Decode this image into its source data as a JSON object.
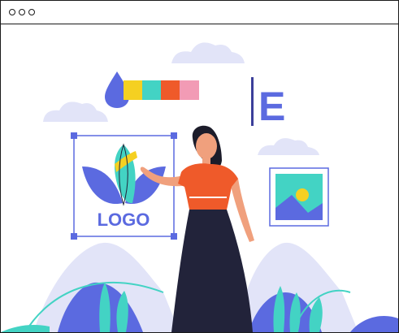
{
  "window": {
    "controls": [
      "window-dot-1",
      "window-dot-2",
      "window-dot-3"
    ]
  },
  "artwork": {
    "logo_text": "LOGO",
    "typography_letter": "E",
    "swatch_colors": [
      "#f5d021",
      "#43d3c4",
      "#ef5a2a",
      "#f29bb5"
    ],
    "colors": {
      "accent": "#5b6ae0",
      "accent_light": "#d9dcf7",
      "cloud": "#e2e4f8",
      "teal": "#43d3c4",
      "orange": "#ef5a2a",
      "skirt": "#22233a",
      "skin": "#f0a07d",
      "hair": "#1c1c2a",
      "sun": "#f5d021"
    },
    "icons": [
      "color-drop-icon",
      "image-icon",
      "text-cursor-icon",
      "lotus-logo-icon"
    ]
  }
}
